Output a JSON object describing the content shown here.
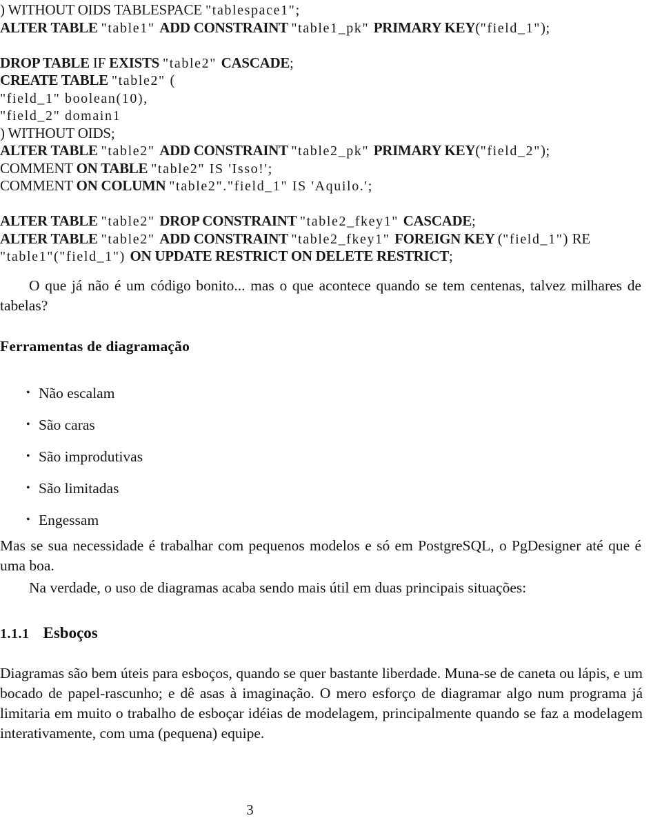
{
  "document": {
    "page_number": "3",
    "language": "pt-BR"
  },
  "code_listing": {
    "name": "sql-code-listing",
    "lines": [
      {
        "id": "line-1",
        "segments": [
          {
            "style": "kwl",
            "text": ") WITHOUT OIDS TABLESPACE "
          },
          {
            "style": "id",
            "text": "\"tablespace1\""
          },
          {
            "style": "pn",
            "text": ";"
          }
        ]
      },
      {
        "id": "line-2",
        "segments": [
          {
            "style": "kw",
            "text": "ALTER TABLE "
          },
          {
            "style": "id",
            "text": "\"table1\" "
          },
          {
            "style": "kw",
            "text": "ADD CONSTRAINT "
          },
          {
            "style": "id",
            "text": "\"table1_pk\" "
          },
          {
            "style": "kw",
            "text": "PRIMARY KEY"
          },
          {
            "style": "pn",
            "text": "("
          },
          {
            "style": "id",
            "text": "\"field_1\""
          },
          {
            "style": "pn",
            "text": ");"
          }
        ]
      },
      {
        "id": "line-3",
        "segments": []
      },
      {
        "id": "line-4",
        "segments": [
          {
            "style": "kw",
            "text": "DROP TABLE "
          },
          {
            "style": "kwl",
            "text": "IF "
          },
          {
            "style": "kw",
            "text": "EXISTS "
          },
          {
            "style": "id",
            "text": "\"table2\" "
          },
          {
            "style": "kw",
            "text": "CASCADE"
          },
          {
            "style": "pn",
            "text": ";"
          }
        ]
      },
      {
        "id": "line-5",
        "segments": [
          {
            "style": "kw",
            "text": "CREATE TABLE "
          },
          {
            "style": "id",
            "text": "\"table2\" "
          },
          {
            "style": "pn",
            "text": "("
          }
        ]
      },
      {
        "id": "line-6",
        "segments": [
          {
            "style": "id",
            "text": "\"field_1\" boolean(10),"
          }
        ]
      },
      {
        "id": "line-7",
        "segments": [
          {
            "style": "id",
            "text": "\"field_2\" domain1"
          }
        ]
      },
      {
        "id": "line-8",
        "segments": [
          {
            "style": "kwl",
            "text": ") WITHOUT OIDS"
          },
          {
            "style": "pn",
            "text": ";"
          }
        ]
      },
      {
        "id": "line-9",
        "segments": [
          {
            "style": "kw",
            "text": "ALTER TABLE "
          },
          {
            "style": "id",
            "text": "\"table2\" "
          },
          {
            "style": "kw",
            "text": "ADD CONSTRAINT "
          },
          {
            "style": "id",
            "text": "\"table2_pk\" "
          },
          {
            "style": "kw",
            "text": "PRIMARY KEY"
          },
          {
            "style": "pn",
            "text": "("
          },
          {
            "style": "id",
            "text": "\"field_2\""
          },
          {
            "style": "pn",
            "text": ");"
          }
        ]
      },
      {
        "id": "line-10",
        "segments": [
          {
            "style": "kwl",
            "text": "COMMENT "
          },
          {
            "style": "kw",
            "text": "ON TABLE "
          },
          {
            "style": "id",
            "text": "\"table2\" IS 'Isso!'"
          },
          {
            "style": "pn",
            "text": ";"
          }
        ]
      },
      {
        "id": "line-11",
        "segments": [
          {
            "style": "kwl",
            "text": "COMMENT "
          },
          {
            "style": "kw",
            "text": "ON COLUMN "
          },
          {
            "style": "id",
            "text": "\"table2\".\"field_1\" IS 'Aquilo.'"
          },
          {
            "style": "pn",
            "text": ";"
          }
        ]
      },
      {
        "id": "line-12",
        "segments": []
      },
      {
        "id": "line-13",
        "segments": [
          {
            "style": "kw",
            "text": "ALTER TABLE "
          },
          {
            "style": "id",
            "text": "\"table2\" "
          },
          {
            "style": "kw",
            "text": "DROP CONSTRAINT "
          },
          {
            "style": "id",
            "text": "\"table2_fkey1\" "
          },
          {
            "style": "kw",
            "text": "CASCADE"
          },
          {
            "style": "pn",
            "text": ";"
          }
        ]
      },
      {
        "id": "line-14",
        "segments": [
          {
            "style": "kw",
            "text": "ALTER TABLE "
          },
          {
            "style": "id",
            "text": "\"table2\" "
          },
          {
            "style": "kw",
            "text": "ADD CONSTRAINT "
          },
          {
            "style": "id",
            "text": "\"table2_fkey1\" "
          },
          {
            "style": "kw",
            "text": "FOREIGN KEY "
          },
          {
            "style": "pn",
            "text": "("
          },
          {
            "style": "id",
            "text": "\"field_1\""
          },
          {
            "style": "pn",
            "text": ") "
          },
          {
            "style": "kwl",
            "text": "RE"
          }
        ]
      },
      {
        "id": "line-15",
        "segments": [
          {
            "style": "id",
            "text": "\"table1\"(\"field_1\") "
          },
          {
            "style": "kw",
            "text": "ON UPDATE RESTRICT ON DELETE RESTRICT"
          },
          {
            "style": "pn",
            "text": ";"
          }
        ]
      }
    ]
  },
  "paragraphs": {
    "p_codigo_bonito": "O que já não é um código bonito...  mas o que acontece quando se tem centenas, talvez milhares de tabelas?",
    "p_pgdesigner": "Mas se sua necessidade é trabalhar com pequenos modelos e só em PostgreSQL, o PgDesigner até que é uma boa.",
    "p_na_verdade": "Na verdade, o uso de diagramas acaba sendo mais útil em duas principais situações:",
    "p_esbocos_body": "Diagramas são bem úteis para esboços, quando se quer bastante liberdade.  Muna-se de caneta ou lápis, e um bocado de papel-rascunho; e dê asas à imaginação. O mero esforço de diagramar algo num programa já limitaria em muito o trabalho de esboçar idéias de modelagem, principalmente quando se faz a modelagem interativamente, com uma (pequena) equipe."
  },
  "headings": {
    "ferramentas": "Ferramentas de diagramação",
    "section_number": "1.1.1",
    "section_title": "Esboços"
  },
  "bullet_list": {
    "name": "drawbacks-list",
    "items": [
      "Não escalam",
      "São caras",
      "São improdutivas",
      "São limitadas",
      "Engessam"
    ]
  }
}
